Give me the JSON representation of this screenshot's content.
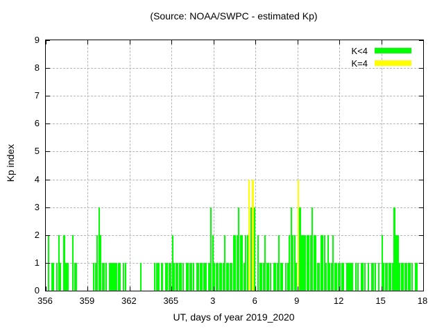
{
  "title": "(Source: NOAA/SWPC - estimated Kp)",
  "legend": [
    {
      "label": "K<4",
      "color": "#00ff00"
    },
    {
      "label": "K=4",
      "color": "#ffff00"
    }
  ],
  "chart_data": {
    "type": "bar",
    "title": "(Source: NOAA/SWPC - estimated Kp)",
    "xlabel": "UT, days of year 2019_2020",
    "ylabel": "Kp index",
    "ylim": [
      0,
      9
    ],
    "xlim_days": [
      "356",
      "18"
    ],
    "grid": true,
    "legend_position": "top-right-inside",
    "bar_color_k_lt_4": "#00ff00",
    "bar_color_k_eq_4": "#ffff00",
    "x_tick_labels": [
      "356",
      "359",
      "362",
      "365",
      "3",
      "6",
      "9",
      "12",
      "15",
      "18"
    ],
    "y_tick_labels": [
      "0",
      "1",
      "2",
      "3",
      "4",
      "5",
      "6",
      "7",
      "8",
      "9"
    ],
    "slots_per_day": 8,
    "slot_hours": 3,
    "days": [
      {
        "day": "356",
        "values": [
          0,
          2,
          0,
          1,
          1,
          0,
          1,
          2
        ]
      },
      {
        "day": "357",
        "values": [
          1,
          0,
          2,
          1,
          1,
          0,
          0,
          2
        ]
      },
      {
        "day": "358",
        "values": [
          1,
          1,
          0,
          0,
          0,
          0,
          0,
          0
        ]
      },
      {
        "day": "359",
        "values": [
          0,
          0,
          0,
          1,
          1,
          2,
          3,
          2
        ]
      },
      {
        "day": "360",
        "values": [
          1,
          1,
          1,
          0,
          1,
          1,
          1,
          1
        ]
      },
      {
        "day": "361",
        "values": [
          1,
          1,
          1,
          0,
          1,
          1,
          0,
          0
        ]
      },
      {
        "day": "362",
        "values": [
          0,
          0,
          0,
          0,
          0,
          0,
          1,
          0
        ]
      },
      {
        "day": "363",
        "values": [
          0,
          0,
          0,
          0,
          0,
          0,
          1,
          1
        ]
      },
      {
        "day": "364",
        "values": [
          1,
          0,
          1,
          0,
          1,
          1,
          1,
          1
        ]
      },
      {
        "day": "365",
        "values": [
          2,
          1,
          1,
          1,
          1,
          1,
          1,
          0
        ]
      },
      {
        "day": "1",
        "values": [
          1,
          1,
          1,
          1,
          1,
          0,
          1,
          1
        ]
      },
      {
        "day": "2",
        "values": [
          1,
          1,
          1,
          1,
          0,
          1,
          3,
          2
        ]
      },
      {
        "day": "3",
        "values": [
          1,
          1,
          1,
          1,
          1,
          1,
          2,
          1
        ]
      },
      {
        "day": "4",
        "values": [
          1,
          1,
          1,
          2,
          2,
          2,
          3,
          2
        ]
      },
      {
        "day": "5",
        "values": [
          2,
          1,
          2,
          2,
          4,
          3,
          4,
          3
        ]
      },
      {
        "day": "6",
        "values": [
          0,
          2,
          1,
          1,
          1,
          2,
          1,
          1
        ]
      },
      {
        "day": "7",
        "values": [
          1,
          0,
          1,
          1,
          1,
          2,
          1,
          1
        ]
      },
      {
        "day": "8",
        "values": [
          0,
          1,
          1,
          2,
          3,
          2,
          2,
          1
        ]
      },
      {
        "day": "9",
        "values": [
          4,
          3,
          2,
          2,
          2,
          2,
          2,
          2
        ]
      },
      {
        "day": "10",
        "values": [
          3,
          2,
          2,
          1,
          1,
          2,
          2,
          2
        ]
      },
      {
        "day": "11",
        "values": [
          1,
          2,
          1,
          1,
          2,
          1,
          1,
          1
        ]
      },
      {
        "day": "12",
        "values": [
          1,
          1,
          1,
          0,
          1,
          1,
          1,
          1
        ]
      },
      {
        "day": "13",
        "values": [
          0,
          1,
          1,
          0,
          1,
          1,
          1,
          0
        ]
      },
      {
        "day": "14",
        "values": [
          1,
          0,
          1,
          1,
          1,
          0,
          1,
          0
        ]
      },
      {
        "day": "15",
        "values": [
          2,
          1,
          1,
          1,
          1,
          1,
          1,
          3
        ]
      },
      {
        "day": "16",
        "values": [
          2,
          2,
          1,
          1,
          1,
          1,
          1,
          1
        ]
      },
      {
        "day": "17",
        "values": [
          1,
          1,
          0,
          1,
          1,
          0,
          0,
          0
        ]
      }
    ]
  }
}
